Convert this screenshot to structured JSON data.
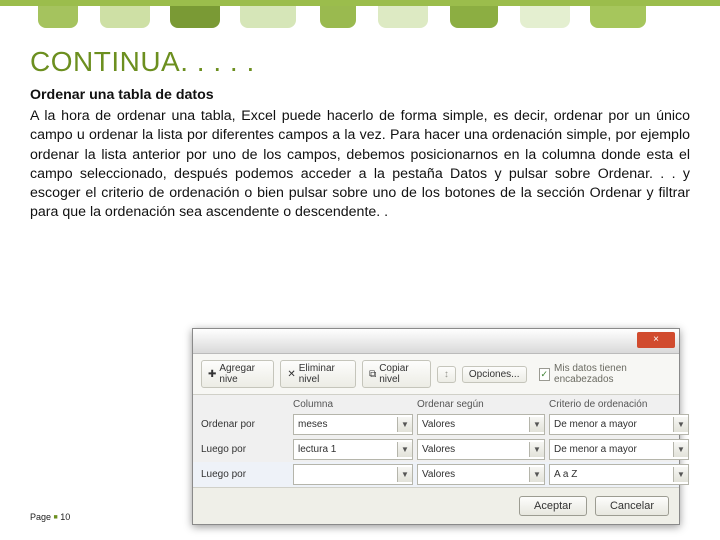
{
  "slide": {
    "title": "CONTINUA. . . . .",
    "heading": "Ordenar una tabla de datos",
    "body": "A la hora de ordenar una tabla, Excel puede hacerlo de forma simple, es decir, ordenar por un único campo u ordenar la lista por diferentes campos a la vez.\nPara hacer una ordenación simple, por ejemplo ordenar la lista anterior por uno de los campos, debemos posicionarnos en la columna donde esta el campo seleccionado, después podemos acceder a la pestaña Datos y pulsar sobre Ordenar. . .  y escoger el criterio de ordenación o bien pulsar sobre uno de los botones de la sección Ordenar y filtrar para que la ordenación sea ascendente o descendente. .",
    "page_label": "Page",
    "page_number": "10"
  },
  "dialog": {
    "close": "×",
    "toolbar": {
      "add": "Agregar nive",
      "delete": "Eliminar nivel",
      "copy": "Copiar nivel",
      "options": "Opciones...",
      "headers": "Mis datos tienen encabezados",
      "checked": "✓"
    },
    "head": {
      "c0": "",
      "c1": "Columna",
      "c2": "Ordenar según",
      "c3": "Criterio de ordenación"
    },
    "rows": [
      {
        "label": "Ordenar por",
        "col": "meses",
        "by": "Valores",
        "crit": "De menor a mayor"
      },
      {
        "label": "Luego por",
        "col": "lectura 1",
        "by": "Valores",
        "crit": "De menor a mayor"
      },
      {
        "label": "Luego por",
        "col": "",
        "by": "Valores",
        "crit": "A a Z"
      }
    ],
    "accept": "Aceptar",
    "cancel": "Cancelar"
  },
  "icons": {
    "dropdown": "▼",
    "plus": "✚",
    "x": "✕",
    "copy": "⧉",
    "updown": "↕"
  }
}
